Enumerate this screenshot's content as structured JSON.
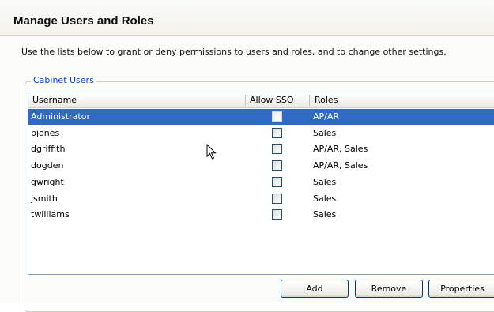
{
  "page": {
    "title": "Manage Users and Roles",
    "description": "Use the lists below to grant or deny permissions to users and roles, and to change other settings."
  },
  "cabinet_users": {
    "legend": "Cabinet Users",
    "columns": {
      "username": "Username",
      "allow_sso": "Allow SSO",
      "roles": "Roles"
    },
    "rows": [
      {
        "username": "Administrator",
        "allow_sso": false,
        "roles": "AP/AR",
        "selected": true
      },
      {
        "username": "bjones",
        "allow_sso": false,
        "roles": "Sales",
        "selected": false
      },
      {
        "username": "dgriffith",
        "allow_sso": false,
        "roles": "AP/AR, Sales",
        "selected": false
      },
      {
        "username": "dogden",
        "allow_sso": false,
        "roles": "AP/AR, Sales",
        "selected": false
      },
      {
        "username": "gwright",
        "allow_sso": false,
        "roles": "Sales",
        "selected": false
      },
      {
        "username": "jsmith",
        "allow_sso": false,
        "roles": "Sales",
        "selected": false
      },
      {
        "username": "twilliams",
        "allow_sso": false,
        "roles": "Sales",
        "selected": false
      }
    ]
  },
  "buttons": {
    "add": "Add",
    "remove": "Remove",
    "properties": "Properties"
  },
  "colors": {
    "selection": "#316ac5",
    "legend_text": "#0046d5",
    "list_border": "#7f9db9"
  },
  "icons": {
    "cursor": "arrow-cursor-icon"
  }
}
